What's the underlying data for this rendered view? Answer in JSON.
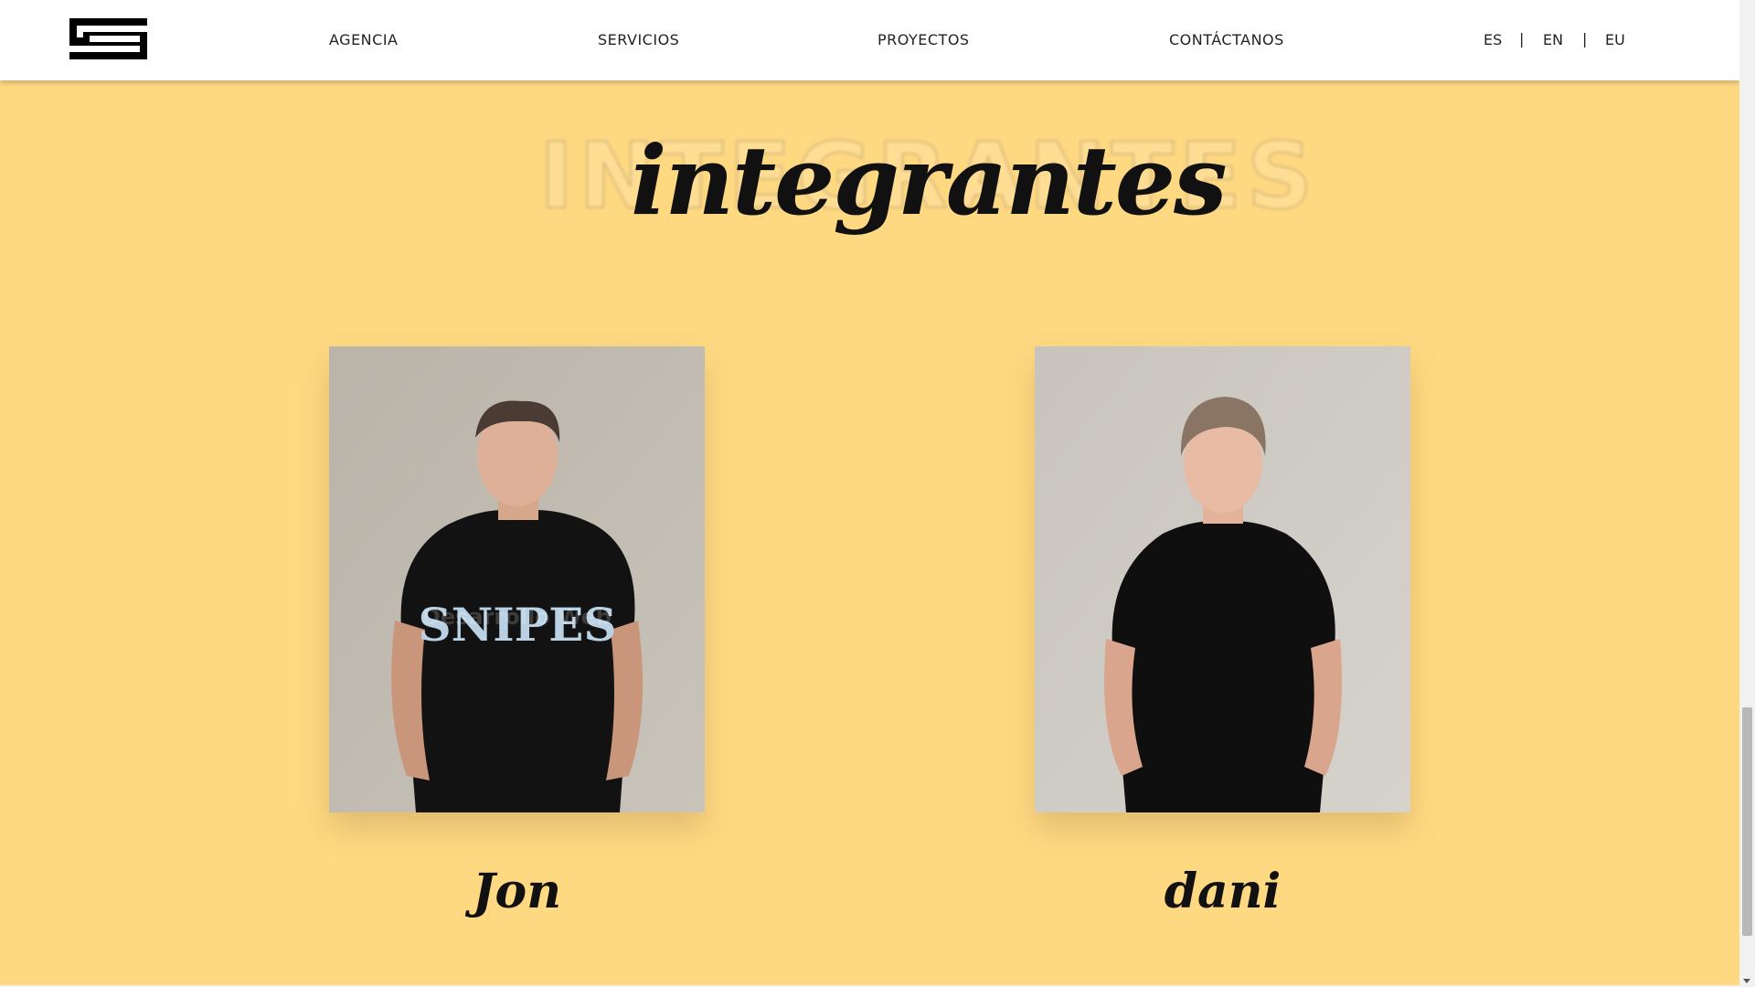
{
  "nav": {
    "items": [
      {
        "label": "AGENCIA"
      },
      {
        "label": "SERVICIOS"
      },
      {
        "label": "PROYECTOS"
      },
      {
        "label": "CONTÁCTANOS"
      }
    ],
    "languages": [
      "ES",
      "EN",
      "EU"
    ],
    "separator": "|"
  },
  "section": {
    "background_title": "INTEGRANTES",
    "title": "integrantes"
  },
  "members": [
    {
      "name": "Jon",
      "photo_watermark": "Desarrollo Web"
    },
    {
      "name": "dani"
    }
  ],
  "colors": {
    "page_background": "#FFD982",
    "header_background": "#ffffff",
    "text": "#111111"
  }
}
